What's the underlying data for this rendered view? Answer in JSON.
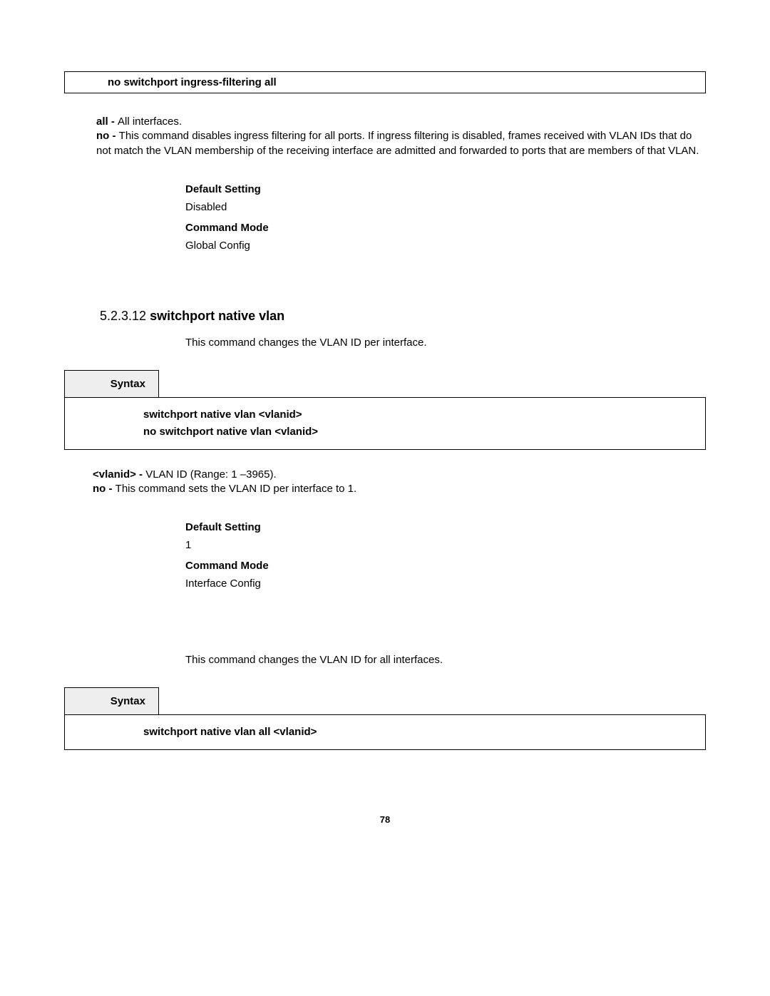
{
  "topBox": {
    "command": "no switchport ingress-filtering all"
  },
  "topParams": {
    "all_label": "all - ",
    "all_desc": "All interfaces.",
    "no_label": "no - ",
    "no_desc": "This command disables ingress filtering for all ports. If ingress filtering is disabled, frames received with VLAN IDs that do not match the VLAN membership of the receiving interface are admitted and forwarded to ports that are members of that VLAN."
  },
  "settings1": {
    "default_label": "Default Setting",
    "default_value": "Disabled",
    "mode_label": "Command Mode",
    "mode_value": "Global Config"
  },
  "section": {
    "number": "5.2.3.12 ",
    "title": "switchport native vlan",
    "desc": "This command changes the VLAN ID per interface."
  },
  "syntax1": {
    "label": "Syntax",
    "line1": "switchport native vlan <vlanid>",
    "line2": "no switchport native vlan <vlanid>"
  },
  "midParams": {
    "vlanid_label": "<vlanid> - ",
    "vlanid_desc": "VLAN ID (Range: 1 –3965).",
    "no_label": "no - ",
    "no_desc": "This command sets the VLAN ID per interface to 1."
  },
  "settings2": {
    "default_label": "Default Setting",
    "default_value": "1",
    "mode_label": "Command Mode",
    "mode_value": "Interface Config"
  },
  "section2_desc": "This command changes the VLAN ID for all interfaces.",
  "syntax2": {
    "label": "Syntax",
    "line1": "switchport native vlan all <vlanid>"
  },
  "page_number": "78"
}
